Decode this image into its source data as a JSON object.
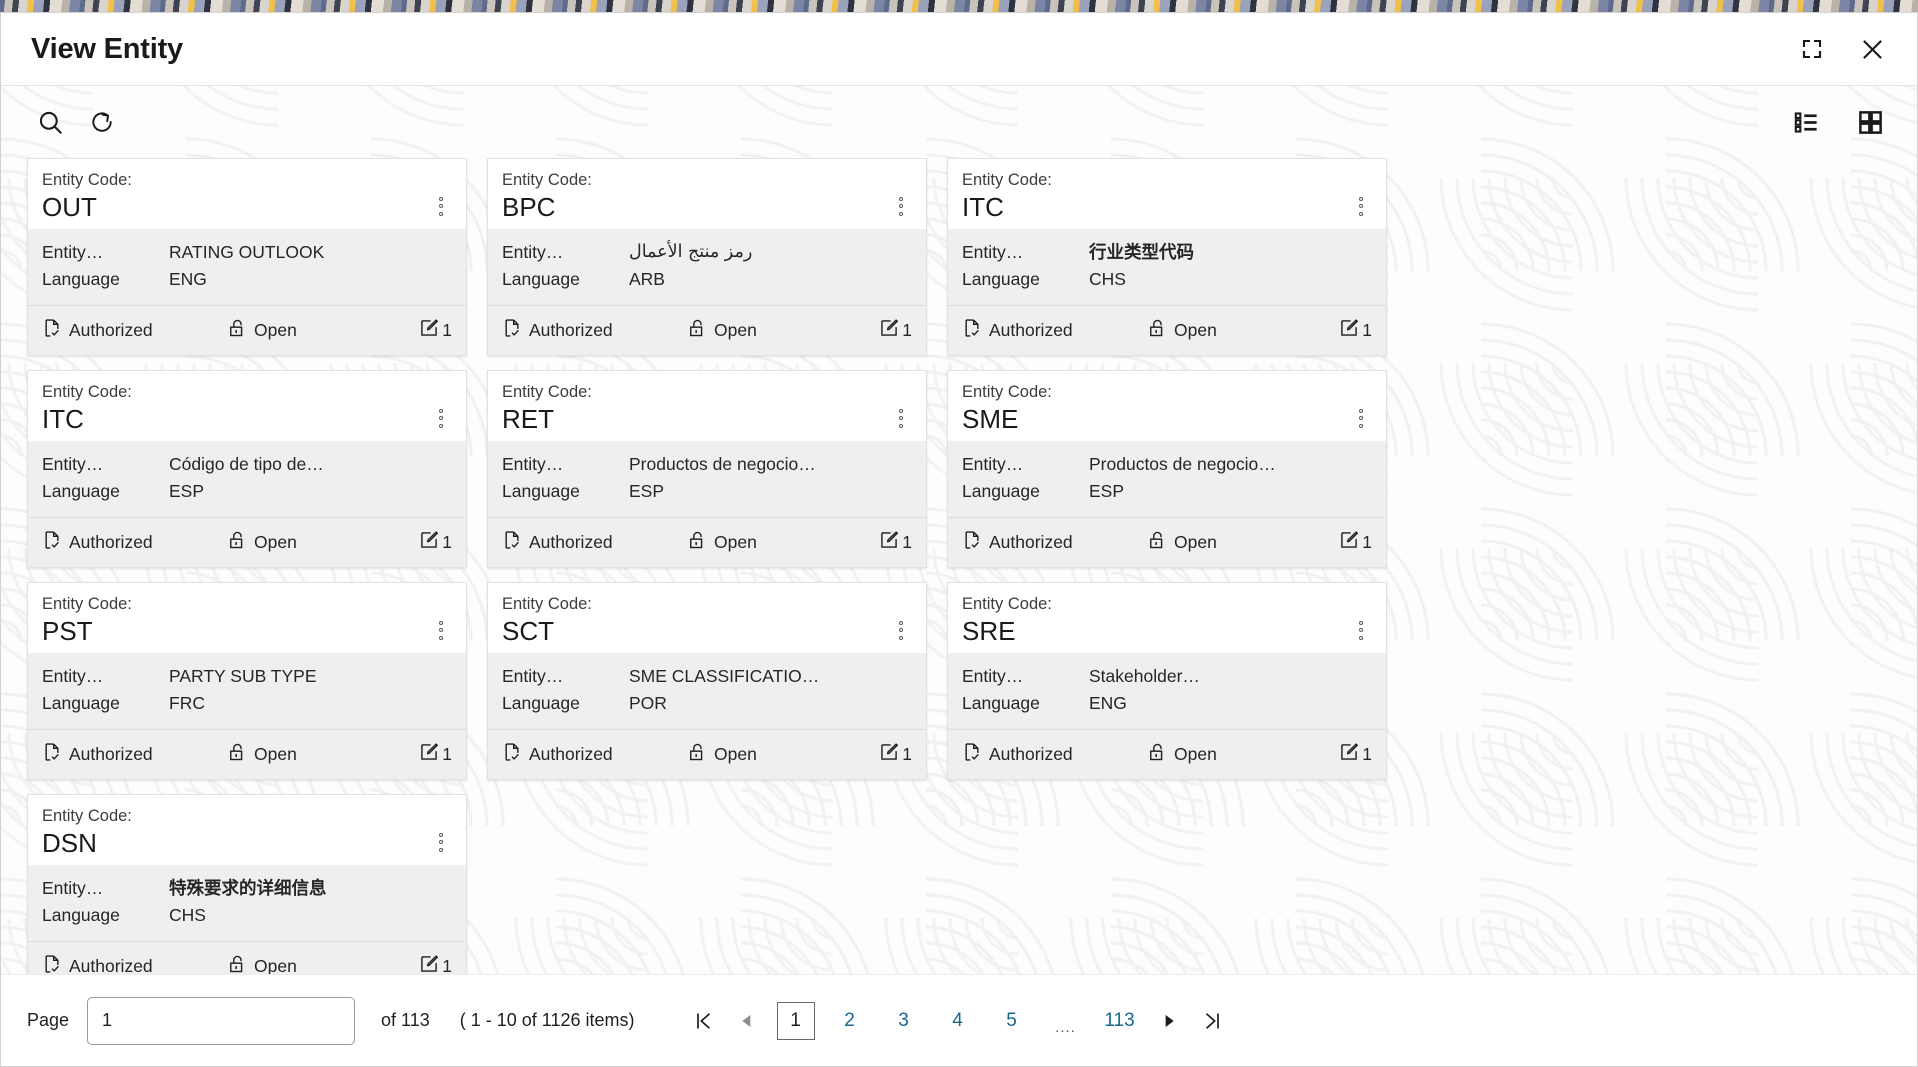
{
  "window": {
    "title": "View Entity",
    "restore_icon": "restore-down-icon",
    "close_icon": "close-icon"
  },
  "toolbar": {
    "search_icon": "search-icon",
    "refresh_icon": "refresh-icon",
    "list_view_icon": "list-view-icon",
    "grid_view_icon": "grid-view-icon"
  },
  "card_labels": {
    "code_label": "Entity Code:",
    "field_label_1": "Entity…",
    "field_label_2": "Language",
    "authorized": "Authorized",
    "open": "Open",
    "edit_count": "1",
    "kebab_icon": "kebab-menu-icon",
    "authorized_icon": "document-check-icon",
    "open_icon": "unlocked-padlock-icon",
    "edit_icon": "edit-square-icon"
  },
  "cards": [
    {
      "code": "OUT",
      "name": "RATING OUTLOOK",
      "language": "ENG",
      "script": "latin",
      "status": "Authorized",
      "lock": "Open",
      "count": "1"
    },
    {
      "code": "BPC",
      "name": "رمز منتج الأعمال",
      "language": "ARB",
      "script": "rtl",
      "status": "Authorized",
      "lock": "Open",
      "count": "1"
    },
    {
      "code": "ITC",
      "name": "行业类型代码",
      "language": "CHS",
      "script": "cjk",
      "status": "Authorized",
      "lock": "Open",
      "count": "1"
    },
    {
      "code": "ITC",
      "name": "Código de tipo de…",
      "language": "ESP",
      "script": "latin",
      "status": "Authorized",
      "lock": "Open",
      "count": "1"
    },
    {
      "code": "RET",
      "name": "Productos de negocio…",
      "language": "ESP",
      "script": "latin",
      "status": "Authorized",
      "lock": "Open",
      "count": "1"
    },
    {
      "code": "SME",
      "name": "Productos de negocio…",
      "language": "ESP",
      "script": "latin",
      "status": "Authorized",
      "lock": "Open",
      "count": "1"
    },
    {
      "code": "PST",
      "name": "PARTY SUB TYPE",
      "language": "FRC",
      "script": "latin",
      "status": "Authorized",
      "lock": "Open",
      "count": "1"
    },
    {
      "code": "SCT",
      "name": "SME CLASSIFICATIO…",
      "language": "POR",
      "script": "latin",
      "status": "Authorized",
      "lock": "Open",
      "count": "1"
    },
    {
      "code": "SRE",
      "name": "Stakeholder…",
      "language": "ENG",
      "script": "latin",
      "status": "Authorized",
      "lock": "Open",
      "count": "1"
    },
    {
      "code": "DSN",
      "name": "特殊要求的详细信息",
      "language": "CHS",
      "script": "cjk",
      "status": "Authorized",
      "lock": "Open",
      "count": "1"
    }
  ],
  "pagination": {
    "page_label": "Page",
    "page_value": "1",
    "page_placeholder": "1",
    "of_text": "of 113",
    "range_text": "( 1 - 10 of 1126 items)",
    "first_icon": "go-to-first-page-icon",
    "prev_icon": "previous-page-icon",
    "next_icon": "next-page-icon",
    "last_icon": "go-to-last-page-icon",
    "pages": [
      "1",
      "2",
      "3",
      "4",
      "5",
      "....",
      "113"
    ],
    "current_page": "1",
    "link_color": "#17688c"
  }
}
